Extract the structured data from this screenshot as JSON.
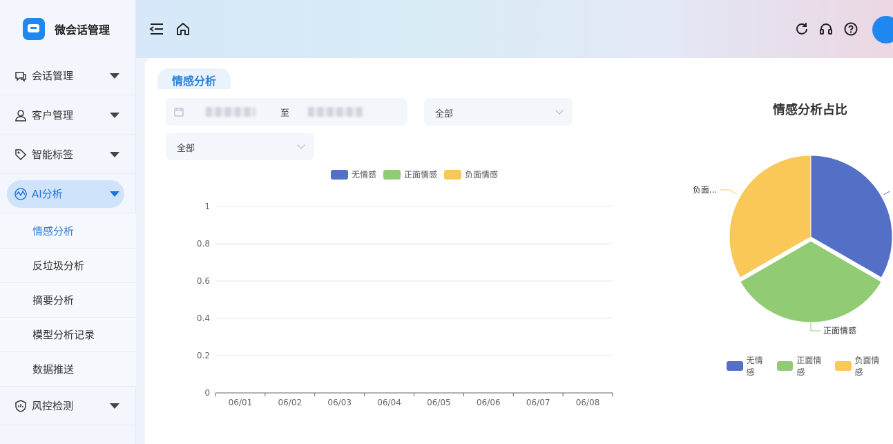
{
  "brand": {
    "name": "微会话管理"
  },
  "sidebar": {
    "items": [
      {
        "label": "会话管理",
        "icon": "chat-icon"
      },
      {
        "label": "客户管理",
        "icon": "user-icon"
      },
      {
        "label": "智能标签",
        "icon": "tag-icon"
      },
      {
        "label": "AI分析",
        "icon": "ai-icon"
      },
      {
        "label": "风控检测",
        "icon": "shield-icon"
      }
    ],
    "ai_sub": [
      "情感分析",
      "反垃圾分析",
      "摘要分析",
      "模型分析记录",
      "数据推送"
    ]
  },
  "header": {
    "icons": [
      "menu-icon",
      "home-icon",
      "refresh-icon",
      "headset-icon",
      "help-icon"
    ]
  },
  "tab": {
    "label": "情感分析"
  },
  "filters": {
    "range_sep": "至",
    "select1": "全部",
    "select2": "全部"
  },
  "colors": {
    "none": "#5470c6",
    "positive": "#91cc75",
    "negative": "#fac858",
    "accent": "#1e87f0"
  },
  "chart_data": [
    {
      "type": "line",
      "legend": [
        "无情感",
        "正面情感",
        "负面情感"
      ],
      "categories": [
        "06/01",
        "06/02",
        "06/03",
        "06/04",
        "06/05",
        "06/06",
        "06/07",
        "06/08"
      ],
      "yticks": [
        "1",
        "0.8",
        "0.6",
        "0.4",
        "0.2",
        "0"
      ],
      "ylim": [
        0,
        1
      ]
    },
    {
      "type": "pie",
      "title": "情感分析占比",
      "slices": [
        {
          "name": "无情感",
          "value": 1,
          "label": ""
        },
        {
          "name": "正面情感",
          "value": 1,
          "label": "正面情感"
        },
        {
          "name": "负面情感",
          "value": 1,
          "label": "负面..."
        }
      ],
      "legend": [
        "无情感",
        "正面情感",
        "负面情感"
      ]
    }
  ]
}
